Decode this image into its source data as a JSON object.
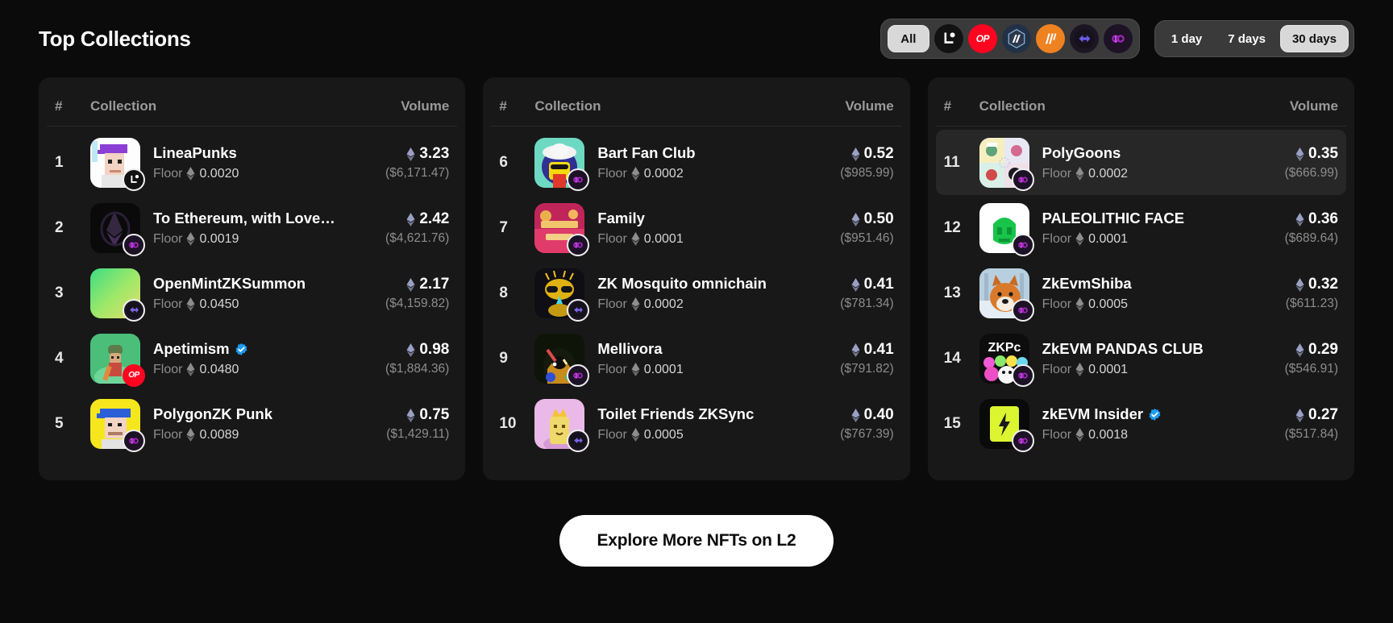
{
  "header": {
    "title": "Top Collections",
    "chain_filter": {
      "all_label": "All",
      "chains": [
        {
          "name": "linea",
          "label": "L"
        },
        {
          "name": "optimism",
          "label": "OP"
        },
        {
          "name": "arbitrum",
          "label": ""
        },
        {
          "name": "arbitrum-nova",
          "label": "N"
        },
        {
          "name": "zksync",
          "label": ""
        },
        {
          "name": "polygon-zkevm",
          "label": ""
        }
      ]
    },
    "time_filter": {
      "options": [
        "1 day",
        "7 days",
        "30 days"
      ],
      "selected": "30 days"
    }
  },
  "table": {
    "columns": {
      "rank": "#",
      "collection": "Collection",
      "volume": "Volume"
    },
    "floor_label": "Floor"
  },
  "columns": [
    {
      "rows": [
        {
          "rank": "1",
          "name": "LineaPunks",
          "verified": false,
          "floor": "0.0020",
          "volume_eth": "3.23",
          "volume_usd": "($6,171.47)",
          "chain": "linea",
          "hover": false,
          "art": "lineapunks"
        },
        {
          "rank": "2",
          "name": "To Ethereum, with Love…",
          "verified": false,
          "floor": "0.0019",
          "volume_eth": "2.42",
          "volume_usd": "($4,621.76)",
          "chain": "polygon-zkevm",
          "hover": false,
          "art": "toeth"
        },
        {
          "rank": "3",
          "name": "OpenMintZKSummon",
          "verified": false,
          "floor": "0.0450",
          "volume_eth": "2.17",
          "volume_usd": "($4,159.82)",
          "chain": "zksync",
          "hover": false,
          "art": "openmint"
        },
        {
          "rank": "4",
          "name": "Apetimism",
          "verified": true,
          "floor": "0.0480",
          "volume_eth": "0.98",
          "volume_usd": "($1,884.36)",
          "chain": "optimism",
          "hover": false,
          "art": "apetimism"
        },
        {
          "rank": "5",
          "name": "PolygonZK Punk",
          "verified": false,
          "floor": "0.0089",
          "volume_eth": "0.75",
          "volume_usd": "($1,429.11)",
          "chain": "polygon-zkevm",
          "hover": false,
          "art": "polygonzk"
        }
      ]
    },
    {
      "rows": [
        {
          "rank": "6",
          "name": "Bart Fan Club",
          "verified": false,
          "floor": "0.0002",
          "volume_eth": "0.52",
          "volume_usd": "($985.99)",
          "chain": "polygon-zkevm",
          "hover": false,
          "art": "bart"
        },
        {
          "rank": "7",
          "name": "Family",
          "verified": false,
          "floor": "0.0001",
          "volume_eth": "0.50",
          "volume_usd": "($951.46)",
          "chain": "polygon-zkevm",
          "hover": false,
          "art": "family"
        },
        {
          "rank": "8",
          "name": "ZK Mosquito omnichain",
          "verified": false,
          "floor": "0.0002",
          "volume_eth": "0.41",
          "volume_usd": "($781.34)",
          "chain": "zksync",
          "hover": false,
          "art": "mosquito"
        },
        {
          "rank": "9",
          "name": "Mellivora",
          "verified": false,
          "floor": "0.0001",
          "volume_eth": "0.41",
          "volume_usd": "($791.82)",
          "chain": "polygon-zkevm",
          "hover": false,
          "art": "mellivora"
        },
        {
          "rank": "10",
          "name": "Toilet Friends ZKSync",
          "verified": false,
          "floor": "0.0005",
          "volume_eth": "0.40",
          "volume_usd": "($767.39)",
          "chain": "zksync",
          "hover": false,
          "art": "toilet"
        }
      ]
    },
    {
      "rows": [
        {
          "rank": "11",
          "name": "PolyGoons",
          "verified": false,
          "floor": "0.0002",
          "volume_eth": "0.35",
          "volume_usd": "($666.99)",
          "chain": "polygon-zkevm",
          "hover": true,
          "art": "polygoons"
        },
        {
          "rank": "12",
          "name": "PALEOLITHIC FACE",
          "verified": false,
          "floor": "0.0001",
          "volume_eth": "0.36",
          "volume_usd": "($689.64)",
          "chain": "polygon-zkevm",
          "hover": false,
          "art": "paleolithic"
        },
        {
          "rank": "13",
          "name": "ZkEvmShiba",
          "verified": false,
          "floor": "0.0005",
          "volume_eth": "0.32",
          "volume_usd": "($611.23)",
          "chain": "polygon-zkevm",
          "hover": false,
          "art": "shiba"
        },
        {
          "rank": "14",
          "name": "ZkEVM PANDAS CLUB",
          "verified": false,
          "floor": "0.0001",
          "volume_eth": "0.29",
          "volume_usd": "($546.91)",
          "chain": "polygon-zkevm",
          "hover": false,
          "art": "pandas"
        },
        {
          "rank": "15",
          "name": "zkEVM Insider",
          "verified": true,
          "floor": "0.0018",
          "volume_eth": "0.27",
          "volume_usd": "($517.84)",
          "chain": "polygon-zkevm",
          "hover": false,
          "art": "insider"
        }
      ]
    }
  ],
  "footer": {
    "explore_label": "Explore More NFTs on L2"
  },
  "colors": {
    "background": "#0b0b0b",
    "panel": "#181818",
    "accent_white": "#ffffff",
    "muted": "#8d8d8d",
    "optimism_red": "#ff0420",
    "nova_orange": "#ef8220",
    "polygon_purple": "#a726c1"
  }
}
